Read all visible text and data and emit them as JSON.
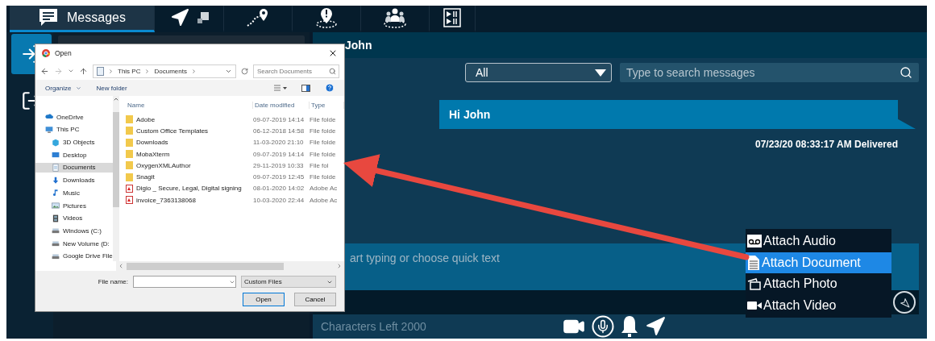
{
  "nav_tabs": [
    {
      "label": "Messages",
      "selected": true
    },
    {
      "selected": false
    },
    {
      "selected": false
    },
    {
      "selected": false
    },
    {
      "selected": false
    },
    {
      "selected": false
    }
  ],
  "rail": [
    {
      "kind": "login",
      "selected": true
    },
    {
      "kind": "logout",
      "selected": false
    }
  ],
  "conversation": {
    "title": "John",
    "filter": {
      "value": "All"
    },
    "search": {
      "placeholder": "Type to search messages"
    },
    "messages": [
      {
        "text": "Hi John",
        "meta": "07/23/20 08:33:17 AM Delivered"
      }
    ],
    "compose": {
      "placeholder": "art typing or choose quick text"
    },
    "characters_left": "Characters Left 2000"
  },
  "attach_menu": [
    {
      "kind": "audio",
      "label": "Attach Audio",
      "selected": false
    },
    {
      "kind": "document",
      "label": "Attach Document",
      "selected": true
    },
    {
      "kind": "photo",
      "label": "Attach Photo",
      "selected": false
    },
    {
      "kind": "video",
      "label": "Attach Video",
      "selected": false
    }
  ],
  "dialog": {
    "title": "Open",
    "path": [
      "This PC",
      "Documents"
    ],
    "search": {
      "placeholder": "Search Documents"
    },
    "toolbar": [
      "Organize",
      "New folder"
    ],
    "nav": [
      {
        "kind": "cloud",
        "label": "OneDrive",
        "selected": false
      },
      {
        "kind": "pc",
        "label": "This PC",
        "selected": false
      },
      {
        "kind": "objects",
        "label": "3D Objects",
        "selected": false
      },
      {
        "kind": "desktop",
        "label": "Desktop",
        "selected": false
      },
      {
        "kind": "documents",
        "label": "Documents",
        "selected": true
      },
      {
        "kind": "downloads",
        "label": "Downloads",
        "selected": false
      },
      {
        "kind": "music",
        "label": "Music",
        "selected": false
      },
      {
        "kind": "pictures",
        "label": "Pictures",
        "selected": false
      },
      {
        "kind": "videos",
        "label": "Videos",
        "selected": false
      },
      {
        "kind": "drive",
        "label": "Windows (C:)",
        "selected": false
      },
      {
        "kind": "drive",
        "label": "New Volume (D:",
        "selected": false
      },
      {
        "kind": "drive",
        "label": "Google Drive File",
        "selected": false
      }
    ],
    "columns": [
      "Name",
      "Date modified",
      "Type"
    ],
    "files": [
      {
        "kind": "folder",
        "name": "Adobe",
        "date": "09-07-2019 14:14",
        "type": "File folde"
      },
      {
        "kind": "folder",
        "name": "Custom Office Templates",
        "date": "06-12-2018 14:58",
        "type": "File folde"
      },
      {
        "kind": "folder",
        "name": "Downloads",
        "date": "11-03-2020 21:10",
        "type": "File folde"
      },
      {
        "kind": "folder",
        "name": "MobaXterm",
        "date": "09-07-2019 14:14",
        "type": "File folde"
      },
      {
        "kind": "folder",
        "name": "OxygenXMLAuthor",
        "date": "29-11-2019 10:33",
        "type": "File fol"
      },
      {
        "kind": "folder",
        "name": "Snagit",
        "date": "09-07-2019 12:45",
        "type": "File folde"
      },
      {
        "kind": "pdf",
        "name": "Digio _ Secure, Legal, Digital signing",
        "date": "08-01-2020 14:02",
        "type": "Adobe Ac"
      },
      {
        "kind": "pdf",
        "name": "invoice_7363138068",
        "date": "10-03-2020 22:44",
        "type": "Adobe Ac"
      }
    ],
    "file_name_label": "File name:",
    "file_type": "Custom Files",
    "buttons": [
      "Open",
      "Cancel"
    ]
  }
}
